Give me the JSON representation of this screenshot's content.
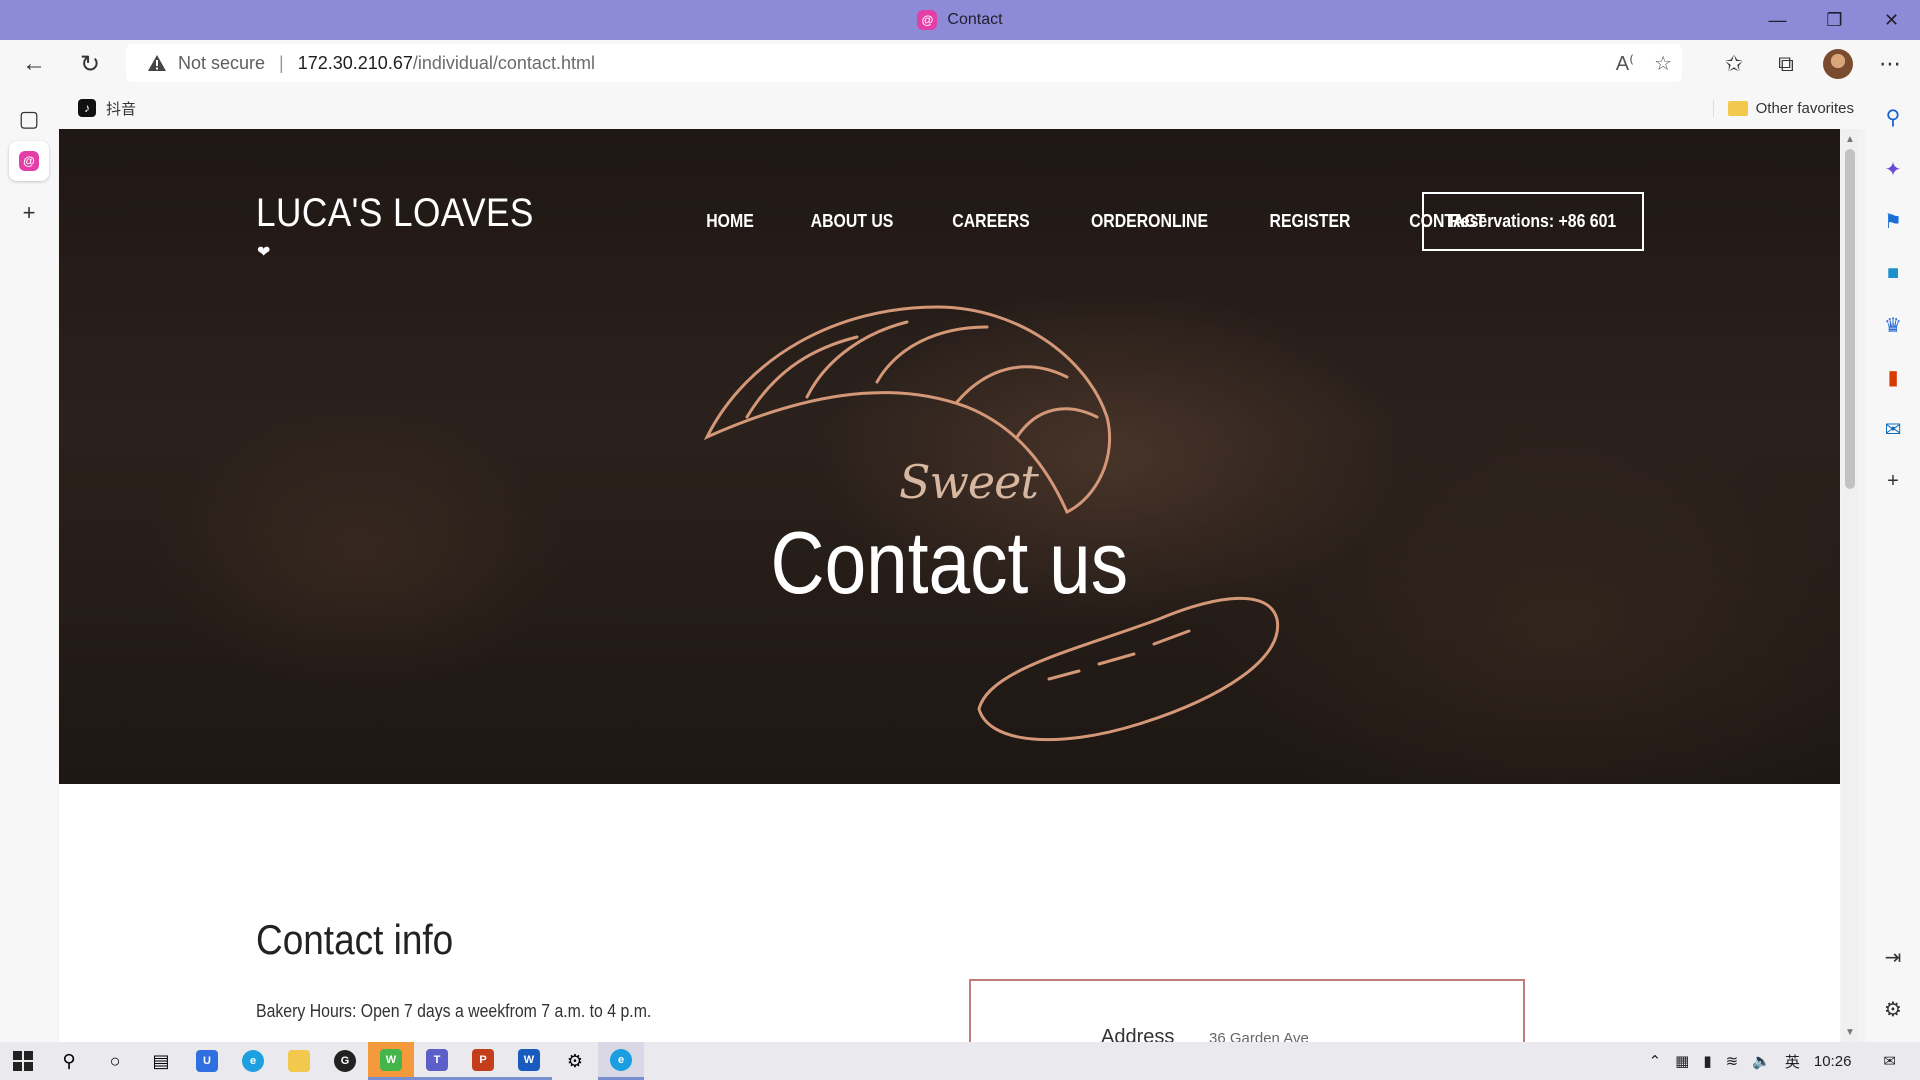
{
  "window": {
    "title": "Contact"
  },
  "address_bar": {
    "security_label": "Not secure",
    "url_host": "172.30.210.67",
    "url_path": "/individual/contact.html"
  },
  "favorites": {
    "items": [
      {
        "label": "抖音"
      }
    ],
    "other_label": "Other favorites"
  },
  "site": {
    "logo": "LUCA'S LOAVES",
    "nav": [
      "HOME",
      "ABOUT US",
      "CAREERS",
      "ORDERONLINE",
      "REGISTER",
      "CONTACT"
    ],
    "reservation": "Reservations: +86 601",
    "hero_script": "Sweet",
    "hero_title": "Contact us",
    "section_title": "Contact info",
    "hours": "Bakery Hours: Open 7 days a weekfrom 7 a.m. to 4 p.m.",
    "address_label": "Address",
    "address_value": "36 Garden Ave"
  },
  "taskbar": {
    "time": "10:26",
    "ime": "英"
  },
  "colors": {
    "titlebar": "#8d8ad8",
    "hero_bg": "#2b211c",
    "card_border": "#c27c7c",
    "favicon": "#e43ea7"
  }
}
